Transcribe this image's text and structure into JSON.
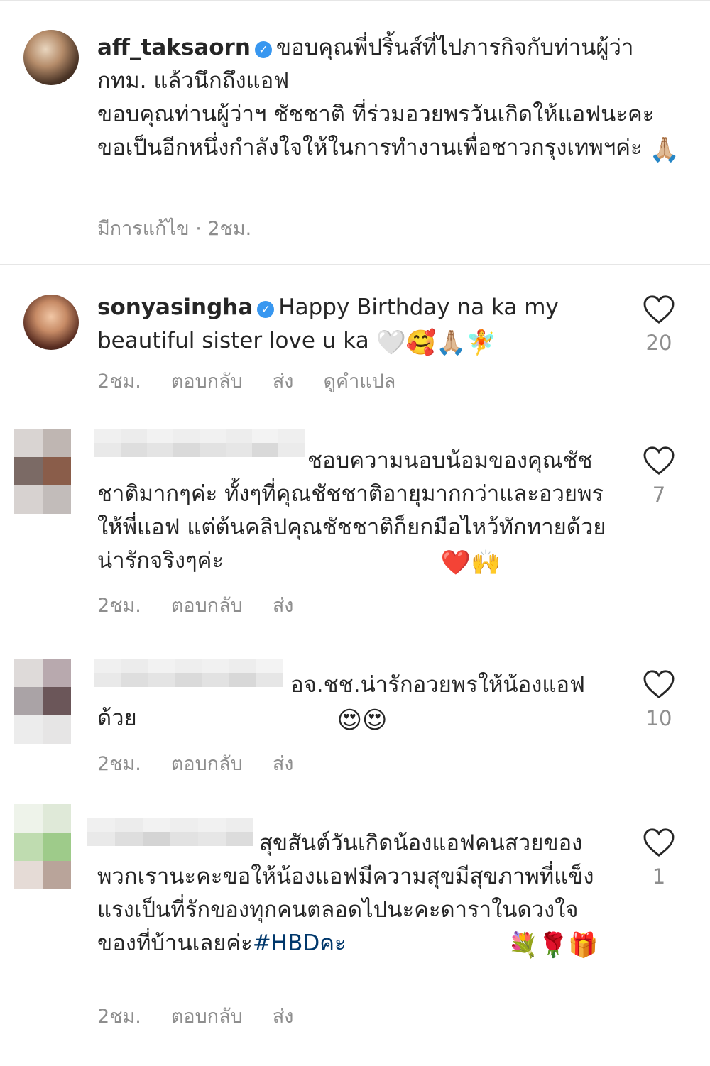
{
  "comments": [
    {
      "username": "aff_taksaorn",
      "text": "ขอบคุณพี่ปริ้นส์ที่ไปภารกิจกับท่านผู้ว่า กทม. แล้วนึกถึงแอฟ\nขอบคุณท่านผู้ว่าฯ ชัชชาติ ที่ร่วมอวยพรวันเกิดให้แอฟนะคะ ขอเป็นอีกหนึ่งกำลังใจให้ในการทำงานเพื่อชาวกรุงเทพฯค่ะ",
      "emoji": "🙏🏼",
      "edited": "มีการแก้ไข",
      "time": "2ชม."
    },
    {
      "username": "sonyasingha",
      "text": "Happy Birthday na ka my beautiful sister love u ka ",
      "emoji": "🤍🥰🙏🏼🧚",
      "time": "2ชม.",
      "reply": "ตอบกลับ",
      "send": "ส่ง",
      "translate": "ดูคำแปล",
      "likes": "20"
    },
    {
      "text": "ชอบความนอบน้อมของคุณชัชชาติมากๆค่ะ ทั้งๆที่คุณชัชชาติอายุมากกว่าและอวยพรให้พี่แอฟ แต่ต้นคลิปคุณชัชชาติก็ยกมือไหว้ทักทายด้วย น่ารักจริงๆค่ะ ",
      "emoji": "❤️🙌",
      "time": "2ชม.",
      "reply": "ตอบกลับ",
      "send": "ส่ง",
      "likes": "7"
    },
    {
      "text": "อจ.ชช.น่ารักอวยพรให้น้องแอฟด้วย",
      "emoji": "😍😍",
      "time": "2ชม.",
      "reply": "ตอบกลับ",
      "send": "ส่ง",
      "likes": "10"
    },
    {
      "text": "สุขสันต์วันเกิดน้องแอฟคนสวยของพวกเรานะคะขอให้น้องแอฟมีความสุขมีสุขภาพที่แข็งแรงเป็นที่รักของทุกคนตลอดไปนะคะดาราในดวงใจของที่บ้านเลยค่ะ",
      "hashtag": "#HBDคะ",
      "emoji": "💐🌹🎁",
      "time": "2ชม.",
      "reply": "ตอบกลับ",
      "send": "ส่ง",
      "likes": "1"
    }
  ],
  "colors": {
    "text": "#262626",
    "meta": "#8e8e8e",
    "verified": "#3897f0",
    "hashtag": "#00376b",
    "divider": "#e6e6e6"
  },
  "icons": {
    "like": "heart-outline-icon",
    "verified": "verified-badge-icon"
  }
}
